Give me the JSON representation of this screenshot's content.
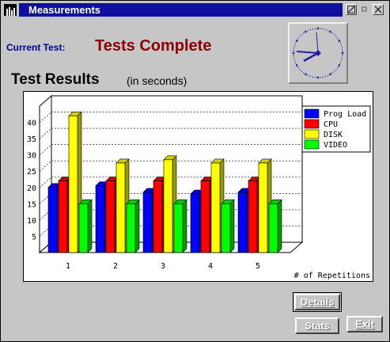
{
  "window": {
    "title": "Measurements"
  },
  "status": {
    "label": "Current Test:",
    "value": "Tests Complete"
  },
  "results": {
    "title": "Test Results",
    "subtitle": "(in seconds)"
  },
  "buttons": {
    "details": "Details",
    "stats": "Stats",
    "exit": "Exit"
  },
  "colors": {
    "title_bar": "#1010a0",
    "status_value": "#8b0000",
    "label": "#00008b"
  },
  "chart_data": {
    "type": "bar",
    "categories": [
      "1",
      "2",
      "3",
      "4",
      "5"
    ],
    "series": [
      {
        "name": "Prog Load",
        "color": "#0000ff",
        "values": [
          20,
          20.5,
          18.5,
          18,
          18.5
        ]
      },
      {
        "name": "CPU",
        "color": "#ff0000",
        "values": [
          22,
          22,
          22,
          22,
          22
        ]
      },
      {
        "name": "DISK",
        "color": "#ffff00",
        "values": [
          42,
          27.5,
          28.5,
          27.5,
          27.5
        ]
      },
      {
        "name": "VIDEO",
        "color": "#00ff00",
        "values": [
          15,
          15,
          15,
          15,
          15
        ]
      }
    ],
    "yticks": [
      "5",
      "10",
      "15",
      "20",
      "25",
      "30",
      "35",
      "40"
    ],
    "xlabel": "# of Repetitions",
    "ylabel": "",
    "ylim": [
      0,
      45
    ],
    "legend": "top-right",
    "grid": true,
    "style": "3d"
  }
}
